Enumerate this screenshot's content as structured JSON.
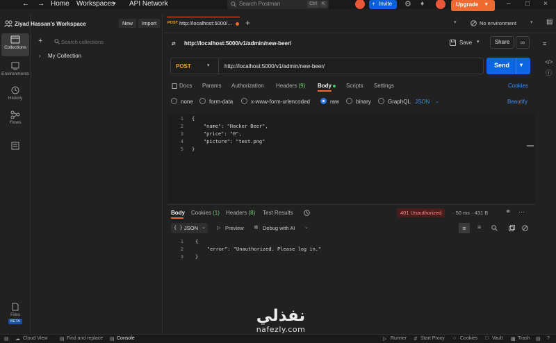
{
  "topbar": {
    "nav": [
      "Home",
      "Workspaces",
      "API Network"
    ],
    "search_placeholder": "Search Postman",
    "shortcut": [
      "Ctrl",
      "K"
    ],
    "invite_label": "Invite",
    "upgrade_label": "Upgrade"
  },
  "rail": {
    "items": [
      "Collections",
      "Environments",
      "History",
      "Flows"
    ],
    "files_label": "Files",
    "files_badge": "BETA"
  },
  "sidebar": {
    "workspace_name": "Ziyad Hassan's Workspace",
    "new_label": "New",
    "import_label": "Import",
    "search_placeholder": "Search collections",
    "collection_name": "My Collection"
  },
  "tabs": {
    "active_method": "POST",
    "active_url": "http://localhost:5000/…",
    "env_label": "No environment"
  },
  "request": {
    "title": "http://localhost:5000/v1/admin/new-beer/",
    "save_label": "Save",
    "share_label": "Share",
    "method": "POST",
    "url": "http://localhost:5000/v1/admin/new-beer/",
    "send_label": "Send",
    "tabs": [
      "Docs",
      "Params",
      "Authorization",
      "Headers",
      "Body",
      "Scripts",
      "Settings"
    ],
    "headers_count": "(9)",
    "cookies_label": "Cookies",
    "body_types": [
      "none",
      "form-data",
      "x-www-form-urlencoded",
      "raw",
      "binary",
      "GraphQL"
    ],
    "format": "JSON",
    "beautify_label": "Beautify",
    "body_lines": [
      "{",
      "    \"name\": \"Hacker Beer\",",
      "    \"price\": \"0\",",
      "    \"picture\": \"test.png\"",
      "}"
    ]
  },
  "response": {
    "tabs": [
      "Body",
      "Cookies",
      "Headers",
      "Test Results"
    ],
    "cookies_count": "(1)",
    "headers_count": "(8)",
    "status": "401 Unauthorized",
    "time": "50 ms",
    "size": "431 B",
    "format": "JSON",
    "preview_label": "Preview",
    "debug_label": "Debug with AI",
    "body_lines": [
      "{",
      "    \"error\": \"Unauthorized. Please log in.\"",
      "}"
    ]
  },
  "statusbar": {
    "left": [
      "Cloud View",
      "Find and replace",
      "Console"
    ],
    "right": [
      "Runner",
      "Start Proxy",
      "Cookies",
      "Vault",
      "Trash"
    ]
  },
  "watermark": {
    "arabic": "نفذلي",
    "latin": "nafezly.com"
  },
  "colors": {
    "accent_orange": "#ee6a2e",
    "send_blue": "#0b66e4",
    "post_method": "#f5a623",
    "error_red": "#ff8a8a"
  }
}
